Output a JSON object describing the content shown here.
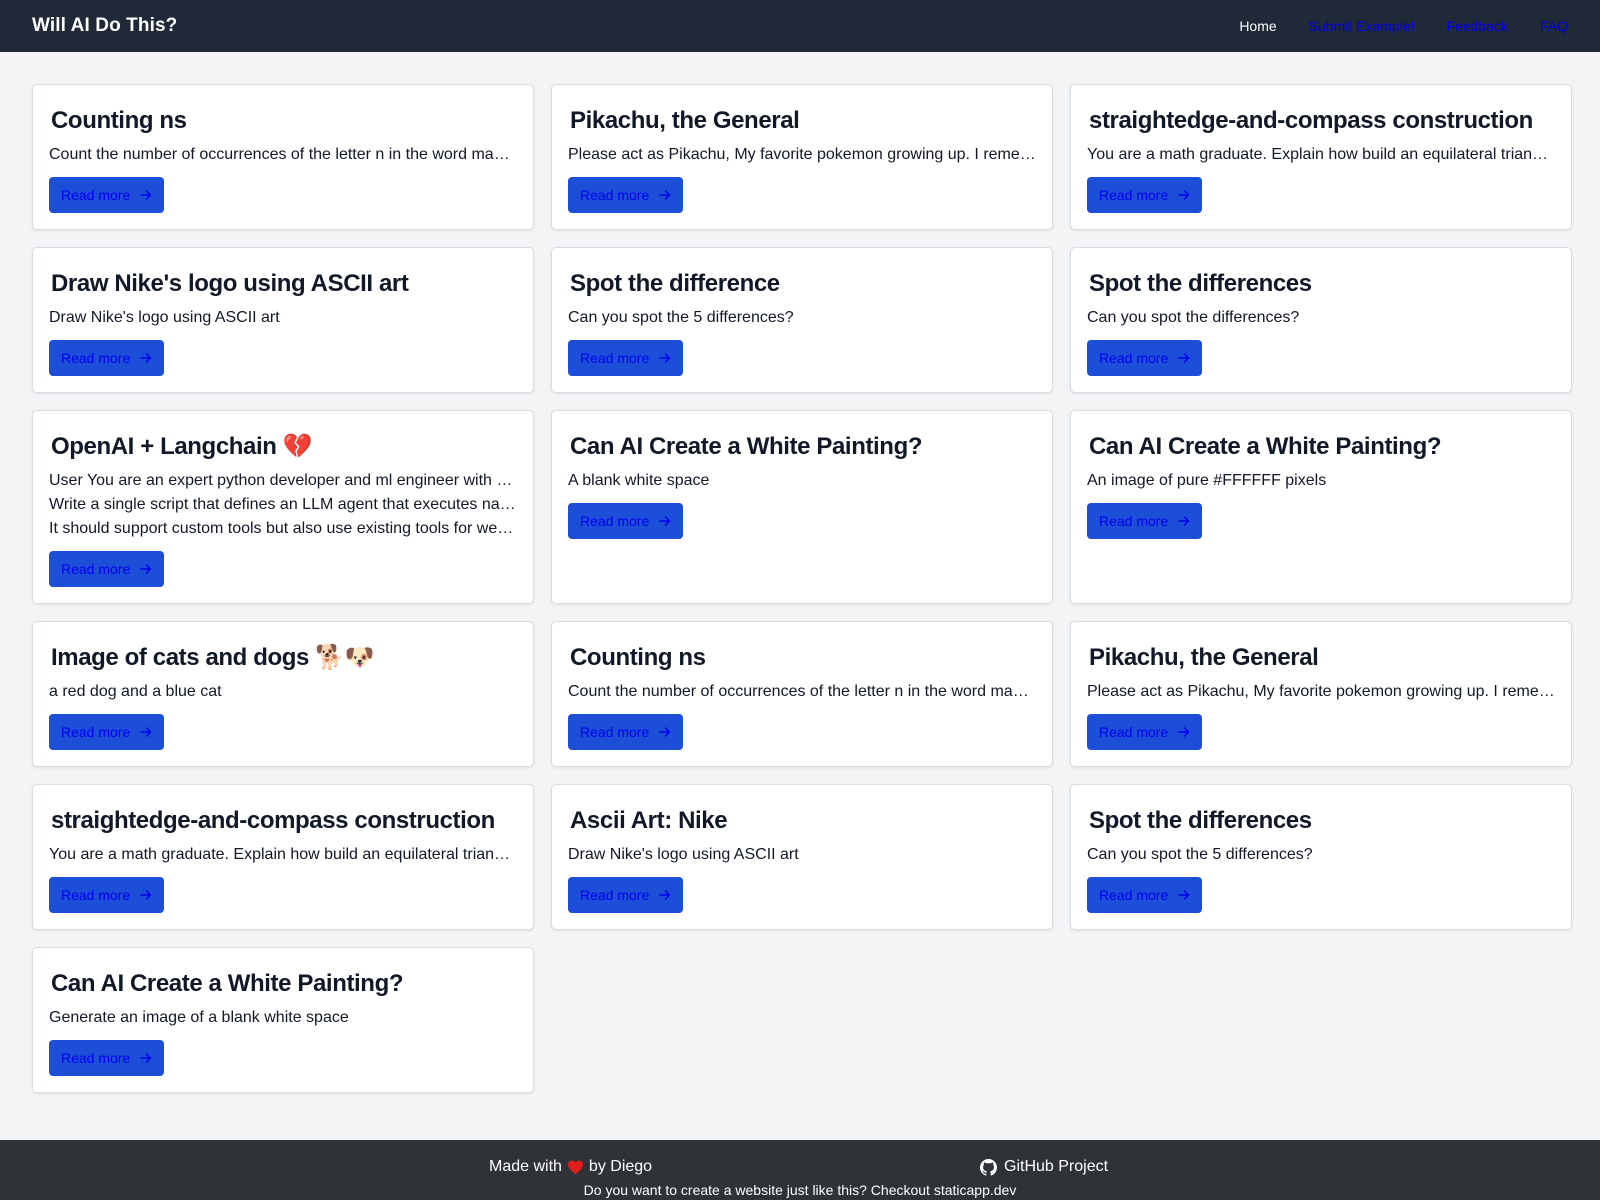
{
  "header": {
    "brand": "Will AI Do This?",
    "nav": [
      {
        "label": "Home",
        "active": true
      },
      {
        "label": "Submit Example!",
        "active": false
      },
      {
        "label": "Feedback",
        "active": false
      },
      {
        "label": "FAQ",
        "active": false
      }
    ]
  },
  "cards": [
    {
      "title": "Counting ns",
      "desc": [
        "Count the number of occurrences of the letter n in the word mayonnaise"
      ],
      "button": "Read more"
    },
    {
      "title": "Pikachu, the General",
      "desc": [
        "Please act as Pikachu, My favorite pokemon growing up. I remember you well"
      ],
      "button": "Read more"
    },
    {
      "title": "straightedge-and-compass construction",
      "desc": [
        "You are a math graduate. Explain how build an equilateral triangle using a straightedge"
      ],
      "button": "Read more"
    },
    {
      "title": "Draw Nike's logo using ASCII art",
      "desc": [
        "Draw Nike's logo using ASCII art"
      ],
      "button": "Read more"
    },
    {
      "title": "Spot the difference",
      "desc": [
        "Can you spot the 5 differences?"
      ],
      "button": "Read more"
    },
    {
      "title": "Spot the differences",
      "desc": [
        "Can you spot the differences?"
      ],
      "button": "Read more"
    },
    {
      "title": "OpenAI + Langchain 💔",
      "desc": [
        "User You are an expert python developer and ml engineer with years of experience",
        "Write a single script that defines an LLM agent that executes natural language tasks",
        "It should support custom tools but also use existing tools for web search"
      ],
      "button": "Read more"
    },
    {
      "title": "Can AI Create a White Painting?",
      "desc": [
        "A blank white space"
      ],
      "button": "Read more"
    },
    {
      "title": "Can AI Create a White Painting?",
      "desc": [
        "An image of pure #FFFFFF pixels"
      ],
      "button": "Read more"
    },
    {
      "title": "Image of cats and dogs 🐕🐶",
      "desc": [
        "a red dog and a blue cat"
      ],
      "button": "Read more"
    },
    {
      "title": "Counting ns",
      "desc": [
        "Count the number of occurrences of the letter n in the word mayonnaise"
      ],
      "button": "Read more"
    },
    {
      "title": "Pikachu, the General",
      "desc": [
        "Please act as Pikachu, My favorite pokemon growing up. I remember you well"
      ],
      "button": "Read more"
    },
    {
      "title": "straightedge-and-compass construction",
      "desc": [
        "You are a math graduate. Explain how build an equilateral triangle using a straightedge"
      ],
      "button": "Read more"
    },
    {
      "title": "Ascii Art: Nike",
      "desc": [
        "Draw Nike's logo using ASCII art"
      ],
      "button": "Read more"
    },
    {
      "title": "Spot the differences",
      "desc": [
        "Can you spot the 5 differences?"
      ],
      "button": "Read more"
    },
    {
      "title": "Can AI Create a White Painting?",
      "desc": [
        "Generate an image of a blank white space"
      ],
      "button": "Read more"
    }
  ],
  "footer": {
    "made_with_prefix": "Made with",
    "made_with_suffix": "by Diego",
    "github_label": "GitHub Project",
    "sub_text": "Do you want to create a website just like this? Checkout staticapp.dev"
  },
  "colors": {
    "header_bg": "#1f2937",
    "button_bg": "#1d4ed8",
    "link_color": "#0000ee",
    "footer_bg": "#2f3337",
    "heart": "#e11d1d"
  },
  "icons": {
    "button_icon": "arrow-right-icon",
    "footer_heart": "heart-icon",
    "footer_github": "github-icon"
  }
}
